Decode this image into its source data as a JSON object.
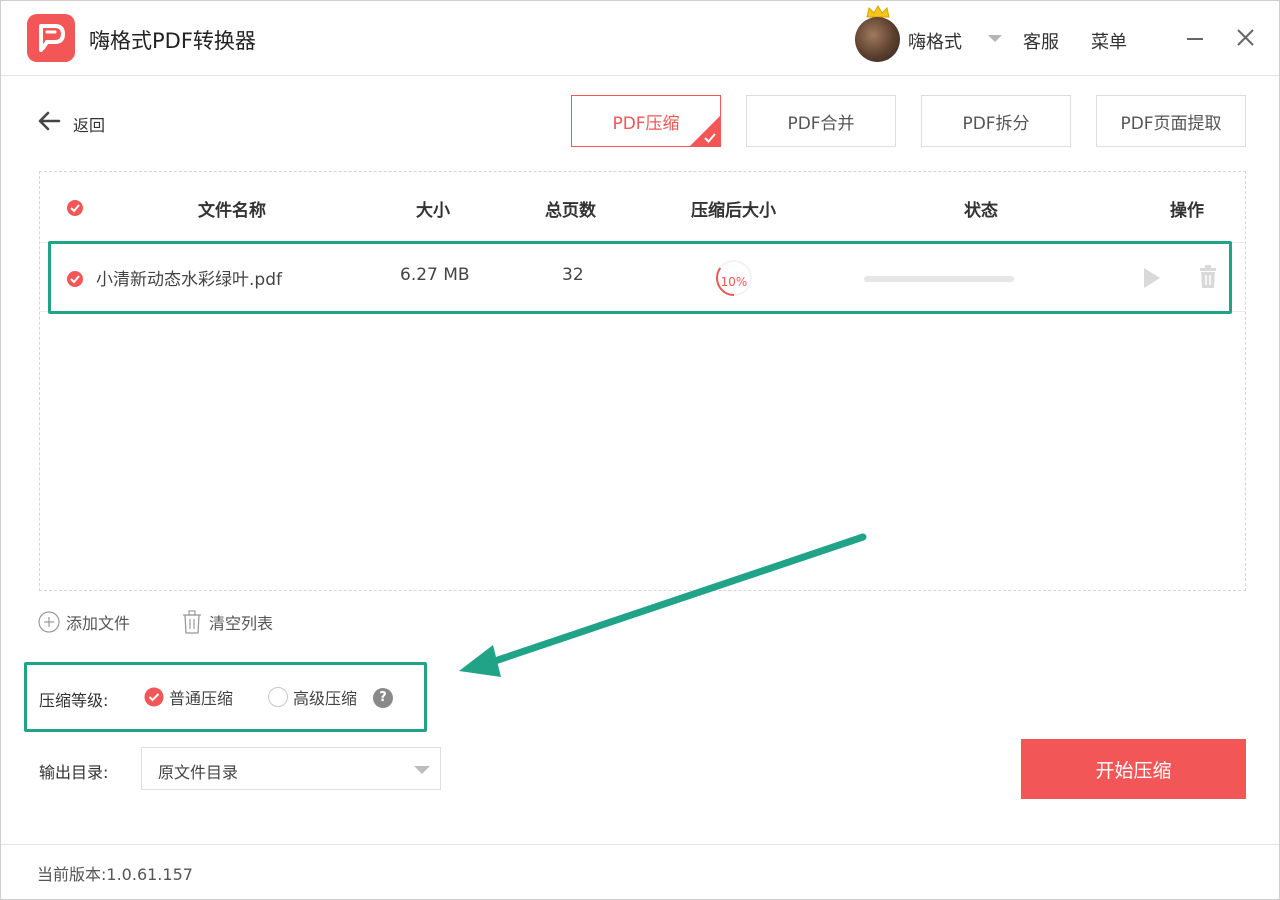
{
  "app": {
    "title": "嗨格式PDF转换器",
    "username": "嗨格式",
    "service_label": "客服",
    "menu_label": "菜单",
    "brand_color": "#f25656",
    "highlight_color": "#20a387"
  },
  "toolbar": {
    "back_label": "返回",
    "tabs": [
      {
        "label": "PDF压缩",
        "active": true
      },
      {
        "label": "PDF合并",
        "active": false
      },
      {
        "label": "PDF拆分",
        "active": false
      },
      {
        "label": "PDF页面提取",
        "active": false
      }
    ]
  },
  "file_table": {
    "columns": [
      "文件名称",
      "大小",
      "总页数",
      "压缩后大小",
      "状态",
      "操作"
    ],
    "rows": [
      {
        "name": "小清新动态水彩绿叶.pdf",
        "size": "6.27 MB",
        "pages": "32",
        "compressed": "10%",
        "compressed_fraction": 0.1,
        "status_progress": 0
      }
    ]
  },
  "list_actions": {
    "add_file": "添加文件",
    "clear_list": "清空列表"
  },
  "compression": {
    "label": "压缩等级:",
    "options": [
      {
        "label": "普通压缩",
        "selected": true
      },
      {
        "label": "高级压缩",
        "selected": false
      }
    ],
    "help_glyph": "?"
  },
  "output": {
    "label": "输出目录:",
    "selected": "原文件目录"
  },
  "start_button": "开始压缩",
  "footer": {
    "version_label": "当前版本:",
    "version": "1.0.61.157"
  }
}
